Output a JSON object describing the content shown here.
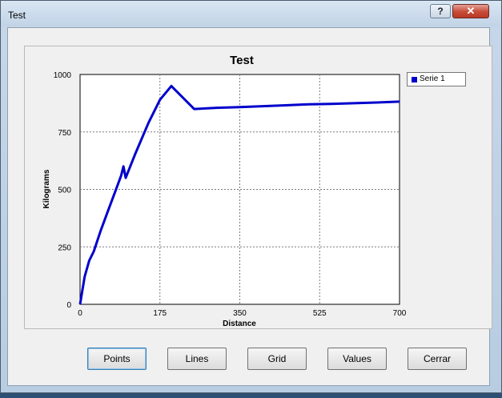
{
  "window": {
    "title": "Test",
    "help_label": "?",
    "close_label": "✕"
  },
  "colors": {
    "series": "#0000cc",
    "grid": "#7a7a7a",
    "plot_bg": "#ffffff"
  },
  "chart_data": {
    "type": "line",
    "title": "Test",
    "xlabel": "Distance",
    "ylabel": "Kilograms",
    "xlim": [
      0,
      700
    ],
    "ylim": [
      0,
      1000
    ],
    "xticks": [
      0,
      175,
      350,
      525,
      700
    ],
    "yticks": [
      0,
      250,
      500,
      750,
      1000
    ],
    "grid": true,
    "legend_position": "right-top",
    "series": [
      {
        "name": "Serie 1",
        "color": "#0000cc",
        "points": [
          [
            0,
            0
          ],
          [
            10,
            120
          ],
          [
            20,
            190
          ],
          [
            30,
            230
          ],
          [
            45,
            320
          ],
          [
            60,
            400
          ],
          [
            75,
            480
          ],
          [
            90,
            560
          ],
          [
            95,
            600
          ],
          [
            100,
            550
          ],
          [
            120,
            650
          ],
          [
            150,
            790
          ],
          [
            175,
            890
          ],
          [
            200,
            950
          ],
          [
            250,
            850
          ],
          [
            300,
            855
          ],
          [
            350,
            858
          ],
          [
            400,
            862
          ],
          [
            450,
            866
          ],
          [
            500,
            870
          ],
          [
            550,
            872
          ],
          [
            600,
            875
          ],
          [
            650,
            878
          ],
          [
            700,
            882
          ]
        ]
      }
    ]
  },
  "buttons": {
    "points": "Points",
    "lines": "Lines",
    "grid": "Grid",
    "values": "Values",
    "close": "Cerrar"
  }
}
